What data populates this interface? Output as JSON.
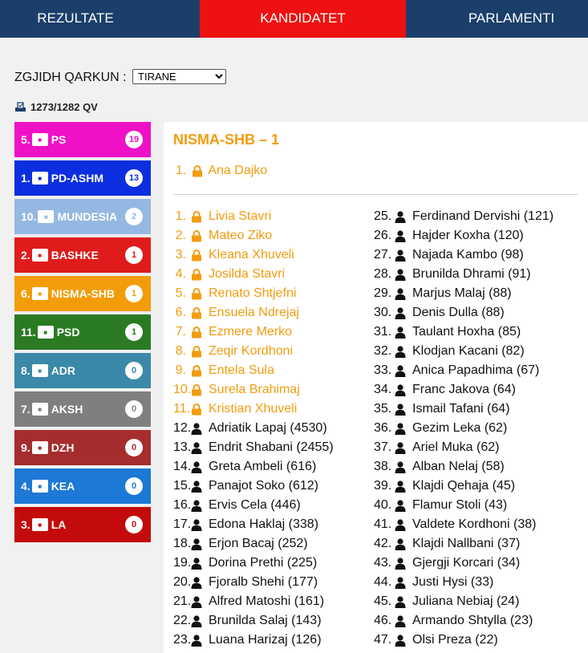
{
  "nav": {
    "tabs": [
      {
        "label": "REZULTATE"
      },
      {
        "label": "KANDIDATET",
        "active": true
      },
      {
        "label": "PARLAMENTI"
      }
    ]
  },
  "qarku": {
    "label": "ZGJIDH QARKUN :",
    "selected": "TIRANE"
  },
  "qv": {
    "text": "1273/1282 QV",
    "icon": "ballot-box-icon"
  },
  "parties": [
    {
      "num": "5.",
      "name": "PS",
      "seats": "19",
      "color": "#ee11c8",
      "badge_color": "#ee11c8"
    },
    {
      "num": "1.",
      "name": "PD-ASHM",
      "seats": "13",
      "color": "#0b2fe0",
      "badge_color": "#0b2fe0"
    },
    {
      "num": "10.",
      "name": "MUNDESIA",
      "seats": "2",
      "color": "#95b8e2",
      "badge_color": "#95b8e2"
    },
    {
      "num": "2.",
      "name": "BASHKE",
      "seats": "1",
      "color": "#e01b1b",
      "badge_color": "#e01b1b"
    },
    {
      "num": "6.",
      "name": "NISMA-SHB",
      "seats": "1",
      "color": "#f39c0a",
      "badge_color": "#f39c0a"
    },
    {
      "num": "11.",
      "name": "PSD",
      "seats": "1",
      "color": "#2a7a24",
      "badge_color": "#2a7a24"
    },
    {
      "num": "8.",
      "name": "ADR",
      "seats": "0",
      "color": "#3b89a8",
      "badge_color": "#3b89a8"
    },
    {
      "num": "7.",
      "name": "AKSH",
      "seats": "0",
      "color": "#7f7f7f",
      "badge_color": "#7f7f7f"
    },
    {
      "num": "9.",
      "name": "DZH",
      "seats": "0",
      "color": "#a52d2d",
      "badge_color": "#a52d2d"
    },
    {
      "num": "4.",
      "name": "KEA",
      "seats": "0",
      "color": "#1d78d6",
      "badge_color": "#1d78d6"
    },
    {
      "num": "3.",
      "name": "LA",
      "seats": "0",
      "color": "#c40b0b",
      "badge_color": "#c40b0b"
    }
  ],
  "panel": {
    "title": "NISMA-SHB – 1",
    "leader": {
      "num": "1.",
      "name": "Ana Dajko"
    },
    "col1": [
      {
        "num": "1.",
        "name": "Livia Stavri",
        "elected": true
      },
      {
        "num": "2.",
        "name": "Mateo Ziko",
        "elected": true
      },
      {
        "num": "3.",
        "name": "Kleana Xhuveli",
        "elected": true
      },
      {
        "num": "4.",
        "name": "Josilda Stavri",
        "elected": true
      },
      {
        "num": "5.",
        "name": "Renato Shtjefni",
        "elected": true
      },
      {
        "num": "6.",
        "name": "Ensuela Ndrejaj",
        "elected": true
      },
      {
        "num": "7.",
        "name": "Ezmere Merko",
        "elected": true
      },
      {
        "num": "8.",
        "name": "Zeqir Kordhoni",
        "elected": true
      },
      {
        "num": "9.",
        "name": "Entela Sula",
        "elected": true
      },
      {
        "num": "10.",
        "name": "Surela Brahimaj",
        "elected": true
      },
      {
        "num": "11.",
        "name": "Kristian Xhuveli",
        "elected": true
      },
      {
        "num": "12.",
        "name": "Adriatik Lapaj (4530)",
        "elected": false
      },
      {
        "num": "13.",
        "name": "Endrit Shabani (2455)",
        "elected": false
      },
      {
        "num": "14.",
        "name": "Greta Ambeli (616)",
        "elected": false
      },
      {
        "num": "15.",
        "name": "Panajot Soko (612)",
        "elected": false
      },
      {
        "num": "16.",
        "name": "Ervis Cela (446)",
        "elected": false
      },
      {
        "num": "17.",
        "name": "Edona Haklaj (338)",
        "elected": false
      },
      {
        "num": "18.",
        "name": "Erjon Bacaj (252)",
        "elected": false
      },
      {
        "num": "19.",
        "name": "Dorina Prethi (225)",
        "elected": false
      },
      {
        "num": "20.",
        "name": "Fjoralb Shehi (177)",
        "elected": false
      },
      {
        "num": "21.",
        "name": "Alfred Matoshi (161)",
        "elected": false
      },
      {
        "num": "22.",
        "name": "Brunilda Salaj (143)",
        "elected": false
      },
      {
        "num": "23.",
        "name": "Luana Harizaj (126)",
        "elected": false
      }
    ],
    "col2": [
      {
        "num": "25.",
        "name": "Ferdinand Dervishi (121)",
        "elected": false
      },
      {
        "num": "26.",
        "name": "Hajder Koxha (120)",
        "elected": false
      },
      {
        "num": "27.",
        "name": "Najada Kambo (98)",
        "elected": false
      },
      {
        "num": "28.",
        "name": "Brunilda Dhrami (91)",
        "elected": false
      },
      {
        "num": "29.",
        "name": "Marjus Malaj (88)",
        "elected": false
      },
      {
        "num": "30.",
        "name": "Denis Dulla (88)",
        "elected": false
      },
      {
        "num": "31.",
        "name": "Taulant Hoxha (85)",
        "elected": false
      },
      {
        "num": "32.",
        "name": "Klodjan Kacani (82)",
        "elected": false
      },
      {
        "num": "33.",
        "name": "Anica Papadhima (67)",
        "elected": false
      },
      {
        "num": "34.",
        "name": "Franc Jakova (64)",
        "elected": false
      },
      {
        "num": "35.",
        "name": "Ismail Tafani (64)",
        "elected": false
      },
      {
        "num": "36.",
        "name": "Gezim Leka (62)",
        "elected": false
      },
      {
        "num": "37.",
        "name": "Ariel Muka (62)",
        "elected": false
      },
      {
        "num": "38.",
        "name": "Alban Nelaj (58)",
        "elected": false
      },
      {
        "num": "39.",
        "name": "Klajdi Qehaja (45)",
        "elected": false
      },
      {
        "num": "40.",
        "name": "Flamur Stoli (43)",
        "elected": false
      },
      {
        "num": "41.",
        "name": "Valdete Kordhoni (38)",
        "elected": false
      },
      {
        "num": "42.",
        "name": "Klajdi Nallbani (37)",
        "elected": false
      },
      {
        "num": "43.",
        "name": "Gjergji Korcari (34)",
        "elected": false
      },
      {
        "num": "44.",
        "name": "Justi Hysi (33)",
        "elected": false
      },
      {
        "num": "45.",
        "name": "Juliana Nebiaj (24)",
        "elected": false
      },
      {
        "num": "46.",
        "name": "Armando Shtylla (23)",
        "elected": false
      },
      {
        "num": "47.",
        "name": "Olsi Preza (22)",
        "elected": false
      }
    ]
  },
  "colors": {
    "nav_bg": "#1b3f6b",
    "active_tab": "#ee1111",
    "elected": "#f29c0f",
    "text": "#111111"
  }
}
